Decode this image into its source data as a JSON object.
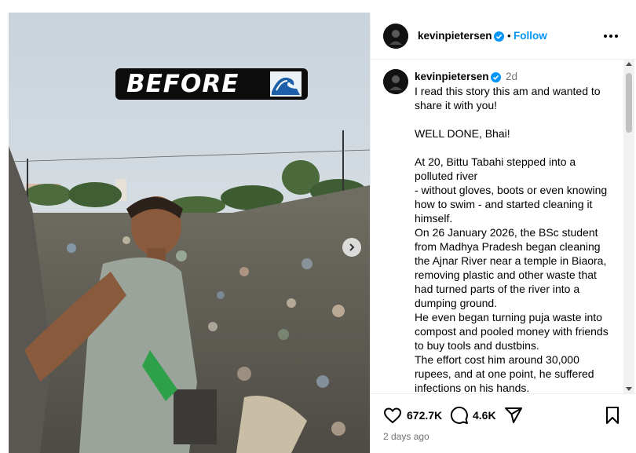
{
  "post": {
    "overlay_text": "BEFORE",
    "wave_icon": "wave-emoji"
  },
  "header": {
    "username": "kevinpietersen",
    "separator": "•",
    "follow_label": "Follow",
    "more_icon": "more-dots-icon"
  },
  "caption": {
    "username": "kevinpietersen",
    "time": "2d",
    "text": "I read this story this am and wanted to share it with you!\n\nWELL DONE, Bhai!\n\nAt 20, Bittu Tabahi stepped into a polluted river\n- without gloves, boots or even knowing how to swim - and started cleaning it himself.\nOn 26 January 2026, the BSc student from Madhya Pradesh began cleaning the Ajnar River near a temple in Biaora, removing plastic and other waste that had turned parts of the river into a dumping ground.\nHe even began turning puja waste into compost and pooled money with friends to buy tools and dustbins.\nThe effort cost him around 30,000 rupees, and at one point, he suffered infections on his hands."
  },
  "actions": {
    "likes": "672.7K",
    "comments": "4.6K",
    "timestamp": "2 days ago"
  },
  "colors": {
    "accent": "#0095f6",
    "verified": "#0095f6",
    "muted": "#737373"
  }
}
